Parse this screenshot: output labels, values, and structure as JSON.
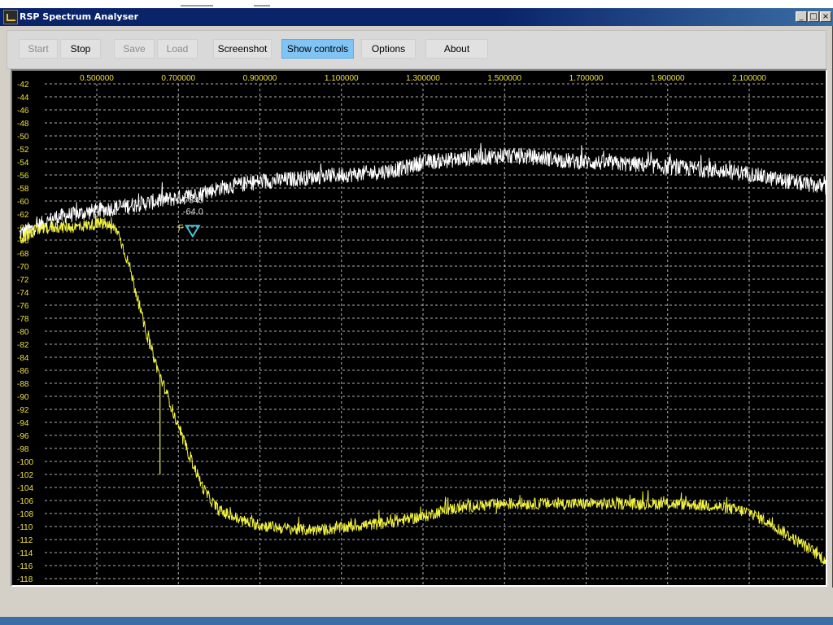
{
  "window": {
    "title": "RSP Spectrum Analyser",
    "controls": {
      "minimize": "_",
      "maximize": "□",
      "close": "×"
    }
  },
  "toolbar": {
    "buttons": [
      {
        "label": "Start",
        "state": "disabled"
      },
      {
        "label": "Stop",
        "state": "normal"
      },
      {
        "label": "Save",
        "state": "disabled"
      },
      {
        "label": "Load",
        "state": "disabled"
      },
      {
        "label": "Screenshot",
        "state": "normal"
      },
      {
        "label": "Show controls",
        "state": "active"
      },
      {
        "label": "Options",
        "state": "normal"
      },
      {
        "label": "About",
        "state": "normal"
      }
    ]
  },
  "chart_data": {
    "type": "line",
    "x_unit": "MHz",
    "xlim": [
      0.31,
      2.305
    ],
    "ylim": [
      -119,
      -41
    ],
    "x_ticks": [
      "0.500000",
      "0.700000",
      "0.900000",
      "1.100000",
      "1.300000",
      "1.500000",
      "1.700000",
      "1.900000",
      "2.100000"
    ],
    "y_ticks": [
      "-42",
      "-44",
      "-46",
      "-48",
      "-50",
      "-52",
      "-54",
      "-56",
      "-58",
      "-60",
      "-62",
      "-64",
      "-66",
      "-68",
      "-70",
      "-72",
      "-74",
      "-76",
      "-78",
      "-80",
      "-82",
      "-84",
      "-86",
      "-88",
      "-90",
      "-92",
      "-94",
      "-96",
      "-98",
      "-100",
      "-102",
      "-104",
      "-106",
      "-108",
      "-110",
      "-112",
      "-114",
      "-116",
      "-118"
    ],
    "grid": true,
    "colors": {
      "background": "#000000",
      "grid": "#d0d0d0",
      "axis_text": "#f0e040",
      "trace_peak": "#ffffff",
      "trace_live": "#f0f040",
      "marker": "#40c8e0"
    },
    "series": [
      {
        "color": "#ffffff",
        "x": [
          0.31,
          0.35,
          0.4,
          0.45,
          0.5,
          0.55,
          0.6,
          0.65,
          0.7,
          0.75,
          0.8,
          0.85,
          0.9,
          0.95,
          1.0,
          1.05,
          1.1,
          1.15,
          1.2,
          1.25,
          1.3,
          1.35,
          1.4,
          1.45,
          1.5,
          1.55,
          1.6,
          1.65,
          1.7,
          1.75,
          1.8,
          1.85,
          1.9,
          1.95,
          2.0,
          2.05,
          2.1,
          2.15,
          2.2,
          2.25,
          2.305
        ],
        "values": [
          -65,
          -64,
          -62.5,
          -62,
          -61.5,
          -61,
          -60.5,
          -60,
          -59.5,
          -59,
          -58,
          -57.5,
          -57,
          -56.8,
          -56.5,
          -56.2,
          -56,
          -55.8,
          -55.5,
          -55,
          -54,
          -53.8,
          -53.5,
          -53.3,
          -53,
          -53.2,
          -53.4,
          -53.8,
          -54,
          -54.2,
          -54.3,
          -54.5,
          -54.8,
          -55,
          -55.2,
          -55.5,
          -55.8,
          -56.5,
          -57,
          -57.5,
          -58
        ]
      },
      {
        "color": "#f0f040",
        "x": [
          0.31,
          0.35,
          0.4,
          0.45,
          0.5,
          0.52,
          0.55,
          0.58,
          0.6,
          0.62,
          0.65,
          0.68,
          0.7,
          0.72,
          0.74,
          0.76,
          0.78,
          0.8,
          0.85,
          0.9,
          0.95,
          1.0,
          1.05,
          1.1,
          1.15,
          1.2,
          1.25,
          1.3,
          1.35,
          1.4,
          1.5,
          1.6,
          1.7,
          1.8,
          1.9,
          1.95,
          2.0,
          2.05,
          2.1,
          2.15,
          2.2,
          2.25,
          2.305
        ],
        "values": [
          -66,
          -64.5,
          -64,
          -64,
          -63.5,
          -63.5,
          -64.5,
          -70,
          -75,
          -80,
          -86,
          -91,
          -95,
          -98,
          -101,
          -104,
          -106,
          -107.5,
          -109,
          -109.8,
          -110.2,
          -110.5,
          -110.5,
          -110.2,
          -109.8,
          -109.5,
          -109,
          -108.5,
          -107.5,
          -107,
          -106.5,
          -106.5,
          -106.5,
          -106.5,
          -106.5,
          -106.6,
          -106.8,
          -107.2,
          -107.8,
          -109.5,
          -111.5,
          -113.5,
          -116
        ]
      }
    ],
    "spikes": [
      {
        "x": 0.535,
        "y": -65
      },
      {
        "x": 0.655,
        "y": -102
      },
      {
        "x": 0.812,
        "y": -108.5
      },
      {
        "x": 1.17,
        "y": -109.5
      },
      {
        "x": 1.48,
        "y": -108
      },
      {
        "x": 1.83,
        "y": -107.5
      },
      {
        "x": 2.0,
        "y": -106.5
      },
      {
        "x": 1.995,
        "y": -106
      },
      {
        "x": 2.225,
        "y": -112
      }
    ],
    "peak_spikes": [
      {
        "x": 0.42,
        "y": -62.5
      },
      {
        "x": 0.88,
        "y": -57.5
      },
      {
        "x": 1.385,
        "y": -53.5
      },
      {
        "x": 1.59,
        "y": -53
      }
    ],
    "marker": {
      "x": 0.735,
      "y": -63.8,
      "label_freq": "0.7345",
      "label_level": "-64.0",
      "label_id": "F"
    }
  }
}
